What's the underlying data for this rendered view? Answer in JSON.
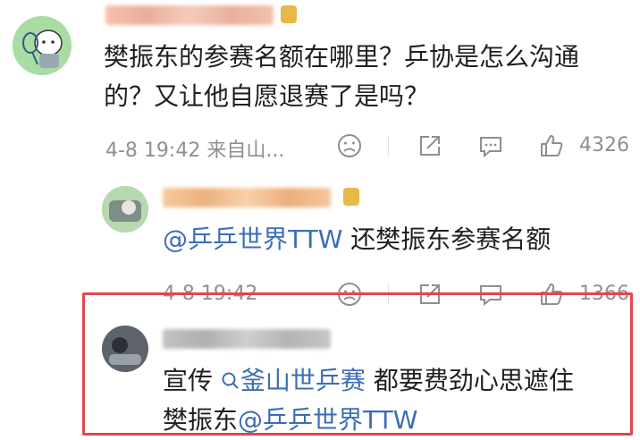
{
  "comment1": {
    "text_line1": "樊振东的参赛名额在哪里？乒协是怎么沟通",
    "text_line2": "的？又让他自愿退赛了是吗？",
    "timestamp": "4-8 19:42",
    "source": "来自山...",
    "like_count": "4326"
  },
  "reply1": {
    "mention": "@乒乒世界TTW",
    "text": " 还樊振东参赛名额",
    "timestamp": "4-8 19:42",
    "like_count": "1366"
  },
  "reply2": {
    "text_prefix": "宣传 ",
    "search_topic": "釜山世乒赛",
    "text_suffix": " 都要费劲心思遮住",
    "text_line2_prefix": "樊振东",
    "mention": "@乒乒世界TTW"
  },
  "colors": {
    "link": "#3b6db5",
    "highlight_border": "#e0474c",
    "meta_gray": "#8f8f8f"
  }
}
